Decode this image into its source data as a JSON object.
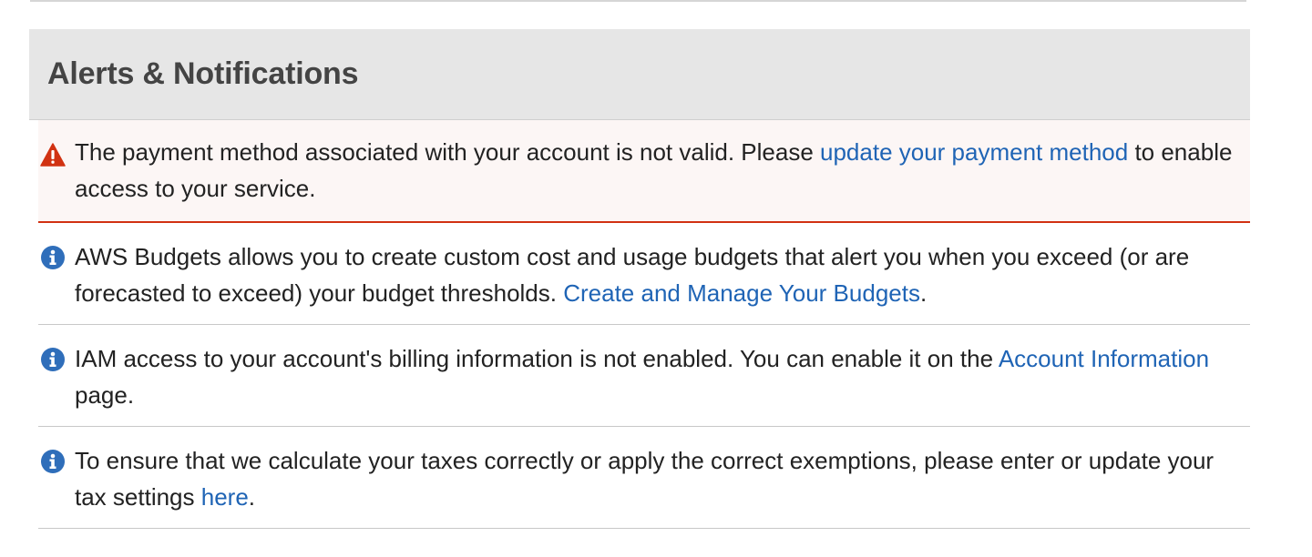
{
  "panel": {
    "title": "Alerts & Notifications"
  },
  "alerts": [
    {
      "type": "error",
      "text_before": "The payment method associated with your account is not valid. Please ",
      "link": "update your payment method",
      "text_after": " to enable access to your service."
    },
    {
      "type": "info",
      "text_before": "AWS Budgets allows you to create custom cost and usage budgets that alert you when you exceed (or are forecasted to exceed) your budget thresholds. ",
      "link": "Create and Manage Your Budgets",
      "text_after": "."
    },
    {
      "type": "info",
      "text_before": "IAM access to your account's billing information is not enabled. You can enable it on the ",
      "link": "Account Information",
      "text_after": " page."
    },
    {
      "type": "info",
      "text_before": "To ensure that we calculate your taxes correctly or apply the correct exemptions, please enter or update your tax settings ",
      "link": "here",
      "text_after": "."
    }
  ],
  "icons": {
    "error": "warning-triangle-icon",
    "info": "info-circle-icon"
  },
  "colors": {
    "link": "#1f64b5",
    "error_accent": "#d13212",
    "error_background": "#fcf6f5",
    "info_icon": "#2f6eba",
    "header_background": "#e6e6e6"
  }
}
